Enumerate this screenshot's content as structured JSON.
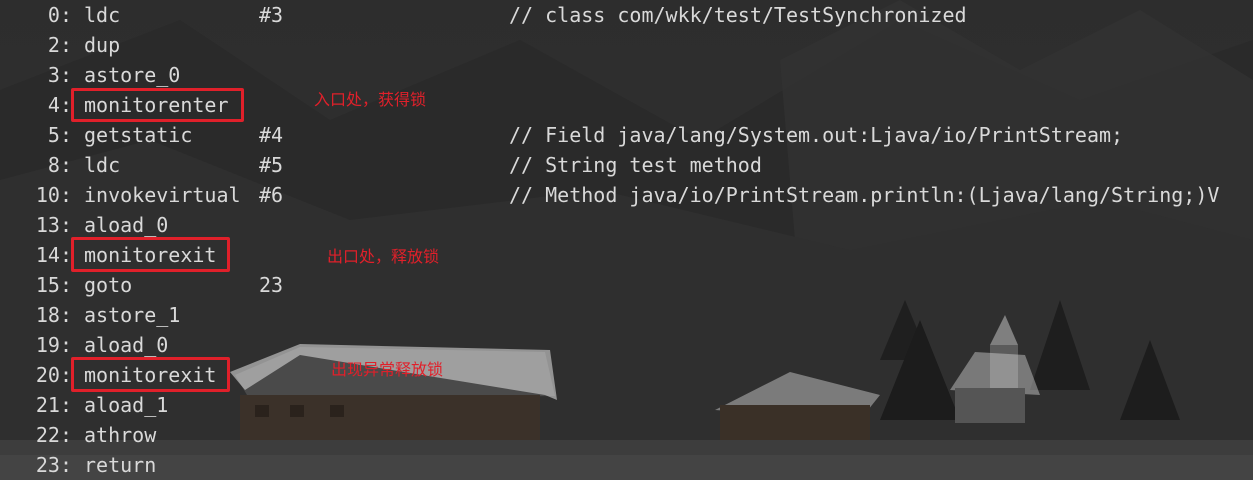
{
  "lines": [
    {
      "num": "0:",
      "op": "ldc",
      "arg": "#3",
      "comment": "// class com/wkk/test/TestSynchronized"
    },
    {
      "num": "2:",
      "op": "dup",
      "arg": "",
      "comment": ""
    },
    {
      "num": "3:",
      "op": "astore_0",
      "arg": "",
      "comment": ""
    },
    {
      "num": "4:",
      "op": "monitorenter",
      "arg": "",
      "comment": ""
    },
    {
      "num": "5:",
      "op": "getstatic",
      "arg": "#4",
      "comment": "// Field java/lang/System.out:Ljava/io/PrintStream;"
    },
    {
      "num": "8:",
      "op": "ldc",
      "arg": "#5",
      "comment": "// String test method"
    },
    {
      "num": "10:",
      "op": "invokevirtual",
      "arg": "#6",
      "comment": "// Method java/io/PrintStream.println:(Ljava/lang/String;)V"
    },
    {
      "num": "13:",
      "op": "aload_0",
      "arg": "",
      "comment": ""
    },
    {
      "num": "14:",
      "op": "monitorexit",
      "arg": "",
      "comment": ""
    },
    {
      "num": "15:",
      "op": "goto",
      "arg": "23",
      "comment": ""
    },
    {
      "num": "18:",
      "op": "astore_1",
      "arg": "",
      "comment": ""
    },
    {
      "num": "19:",
      "op": "aload_0",
      "arg": "",
      "comment": ""
    },
    {
      "num": "20:",
      "op": "monitorexit",
      "arg": "",
      "comment": ""
    },
    {
      "num": "21:",
      "op": "aload_1",
      "arg": "",
      "comment": ""
    },
    {
      "num": "22:",
      "op": "athrow",
      "arg": "",
      "comment": ""
    },
    {
      "num": "23:",
      "op": "return",
      "arg": "",
      "comment": ""
    }
  ],
  "annotations": {
    "entry": "入口处，获得锁",
    "exit": "出口处，释放锁",
    "exception_exit": "出现异常释放锁"
  },
  "colors": {
    "highlight": "#e0202a",
    "code_text": "#d9d9d9",
    "background": "#2b2b2b"
  }
}
